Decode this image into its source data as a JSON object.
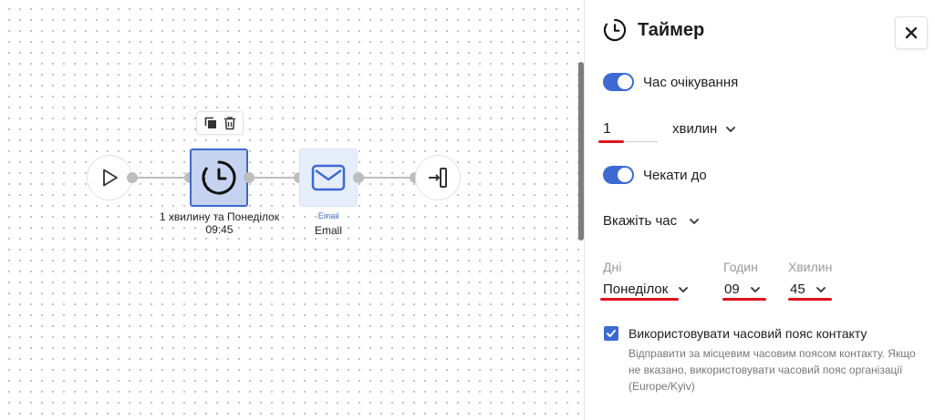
{
  "flow": {
    "timer_node_label": "1 хвилину та Понеділок 09:45",
    "email_node_type": "Email",
    "email_node_label": "Email"
  },
  "panel": {
    "title": "Таймер",
    "wait_time": {
      "label": "Час очікування",
      "enabled": true,
      "value": "1",
      "unit": "хвилин"
    },
    "wait_until": {
      "label": "Чекати до",
      "enabled": true,
      "mode": "Вкажіть час",
      "days_label": "Дні",
      "day_value": "Понеділок",
      "hours_label": "Годин",
      "hours_value": "09",
      "minutes_label": "Хвилин",
      "minutes_value": "45"
    },
    "timezone": {
      "checked": true,
      "label": "Використовувати часовий пояс контакту",
      "help": "Відправити за місцевим часовим поясом контакту. Якщо не вказано, використовувати часовий пояс організації (Europe/Kyiv)"
    }
  },
  "colors": {
    "accent": "#3c6ad2",
    "timer_node_fill": "#c5d3f1",
    "email_node_fill": "#e6edfb",
    "required_underline": "#e0131d"
  },
  "icons": [
    "play-icon",
    "copy-icon",
    "trash-icon",
    "timer-icon",
    "envelope-icon",
    "exit-icon",
    "close-icon",
    "chevron-down-icon",
    "check-icon"
  ]
}
